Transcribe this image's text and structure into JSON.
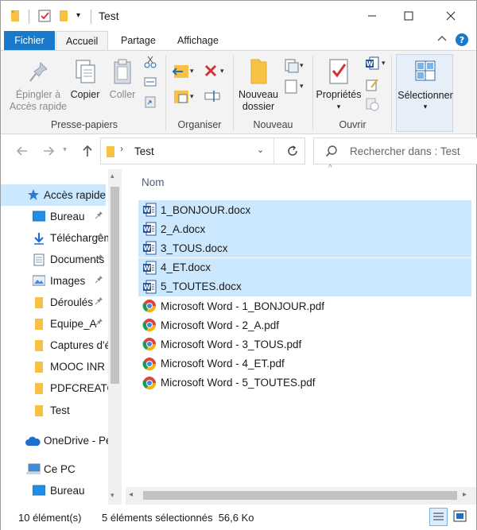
{
  "window": {
    "title": "Test"
  },
  "tabs": {
    "file": "Fichier",
    "home": "Accueil",
    "share": "Partage",
    "view": "Affichage"
  },
  "ribbon": {
    "pin": "Épingler à\nAccès rapide",
    "copy": "Copier",
    "paste": "Coller",
    "clipboard_group": "Presse-papiers",
    "organize_group": "Organiser",
    "new_folder": "Nouveau\ndossier",
    "new_group": "Nouveau",
    "properties": "Propriétés",
    "open_group": "Ouvrir",
    "select": "Sélectionner"
  },
  "address": {
    "path": "Test",
    "search_placeholder": "Rechercher dans : Test"
  },
  "nav": {
    "quick_access": "Accès rapide",
    "items": [
      {
        "label": "Bureau",
        "icon": "desktop-icon",
        "pinned": true
      },
      {
        "label": "Téléchargements",
        "icon": "download-icon",
        "pinned": true
      },
      {
        "label": "Documents",
        "icon": "documents-icon",
        "pinned": true
      },
      {
        "label": "Images",
        "icon": "images-icon",
        "pinned": true
      },
      {
        "label": "Déroulés",
        "icon": "folder-icon",
        "pinned": true
      },
      {
        "label": "Equipe_A",
        "icon": "folder-icon",
        "pinned": true
      },
      {
        "label": "Captures d'écran",
        "icon": "folder-icon",
        "pinned": false
      },
      {
        "label": "MOOC INR",
        "icon": "folder-icon",
        "pinned": false
      },
      {
        "label": "PDFCREATOR",
        "icon": "folder-icon",
        "pinned": false
      },
      {
        "label": "Test",
        "icon": "folder-icon",
        "pinned": false
      }
    ],
    "onedrive": "OneDrive - Pe",
    "this_pc": "Ce PC",
    "this_pc_items": [
      {
        "label": "Bureau"
      }
    ]
  },
  "filelist": {
    "column_name": "Nom",
    "files": [
      {
        "name": "1_BONJOUR.docx",
        "type": "word",
        "selected": true
      },
      {
        "name": "2_A.docx",
        "type": "word",
        "selected": true
      },
      {
        "name": "3_TOUS.docx",
        "type": "word",
        "selected": true
      },
      {
        "name": "4_ET.docx",
        "type": "word",
        "selected": true
      },
      {
        "name": "5_TOUTES.docx",
        "type": "word",
        "selected": true
      },
      {
        "name": "Microsoft Word - 1_BONJOUR.pdf",
        "type": "pdf-chrome",
        "selected": false
      },
      {
        "name": "Microsoft Word - 2_A.pdf",
        "type": "pdf-chrome",
        "selected": false
      },
      {
        "name": "Microsoft Word - 3_TOUS.pdf",
        "type": "pdf-chrome",
        "selected": false
      },
      {
        "name": "Microsoft Word - 4_ET.pdf",
        "type": "pdf-chrome",
        "selected": false
      },
      {
        "name": "Microsoft Word - 5_TOUTES.pdf",
        "type": "pdf-chrome",
        "selected": false
      }
    ]
  },
  "status": {
    "count": "10 élément(s)",
    "selection": "5 éléments sélectionnés  56,6 Ko"
  }
}
